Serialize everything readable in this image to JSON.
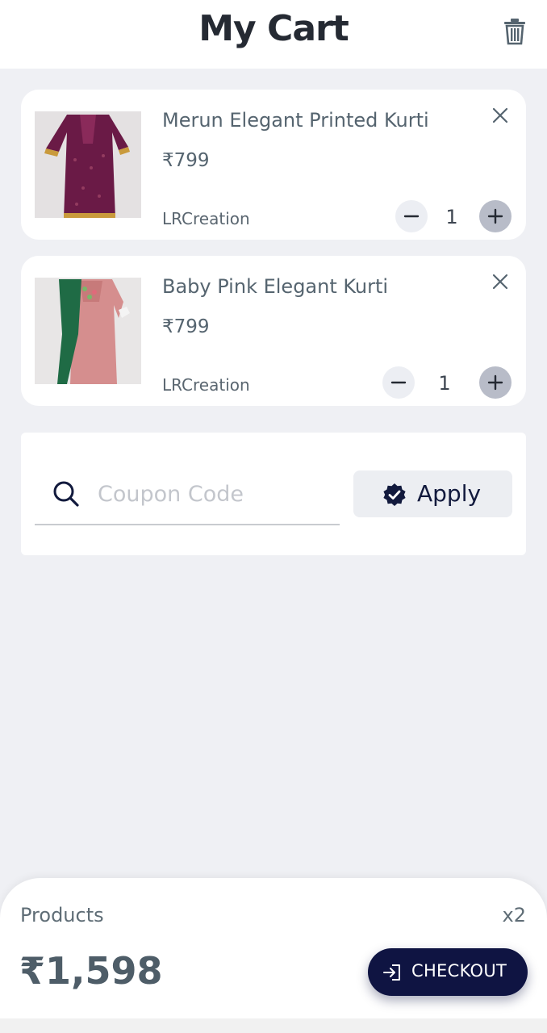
{
  "header": {
    "title": "My Cart",
    "clear_icon": "trash-icon"
  },
  "cart": {
    "items": [
      {
        "title": "Merun Elegant Printed Kurti",
        "price": "₹799",
        "seller": "LRCreation",
        "quantity": "1",
        "image_colors": [
          "#6a1a46",
          "#c99a3c"
        ]
      },
      {
        "title": "Baby Pink Elegant Kurti",
        "price": "₹799",
        "seller": "LRCreation",
        "quantity": "1",
        "image_colors": [
          "#d58e8e",
          "#1f6b45"
        ]
      }
    ]
  },
  "coupon": {
    "placeholder": "Coupon Code",
    "value": "",
    "apply_label": "Apply"
  },
  "summary": {
    "products_label": "Products",
    "products_count": "x2",
    "total": "₹1,598",
    "checkout_label": "CHECKOUT"
  },
  "colors": {
    "accent": "#0f1442",
    "background": "#eff0f4"
  }
}
